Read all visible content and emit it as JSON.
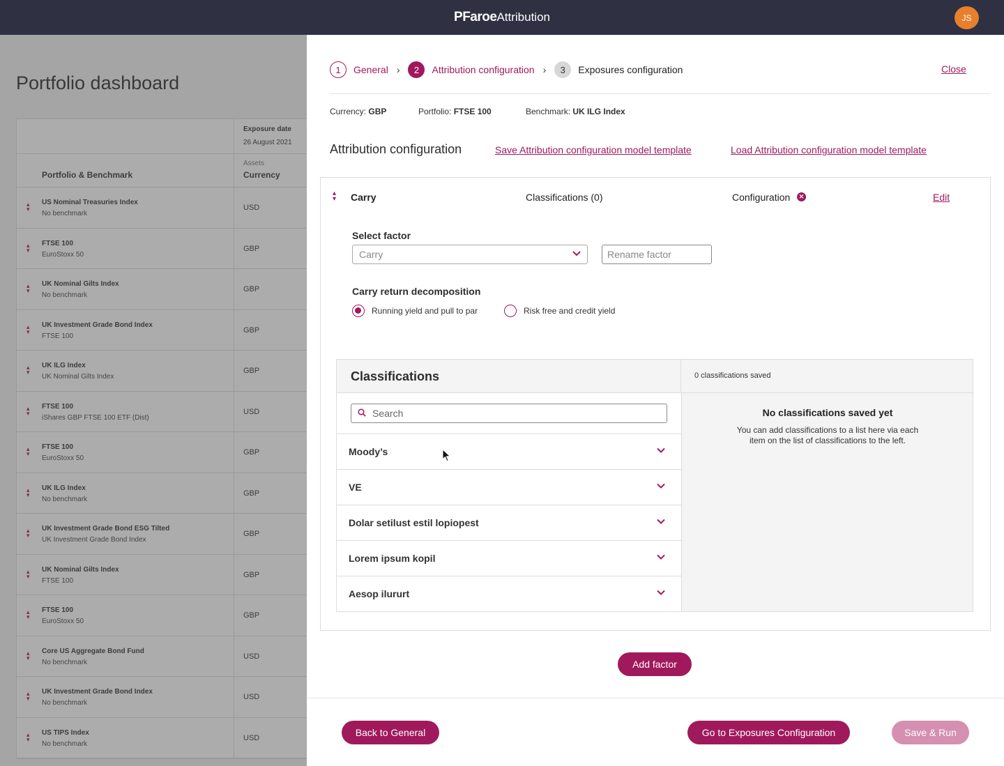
{
  "app": {
    "brand_bold": "PFaroe",
    "brand_rest": "Attribution",
    "avatar_initials": "JS"
  },
  "dashboard": {
    "title": "Portfolio dashboard",
    "exposure_label": "Exposure date",
    "exposure_value": "26 August 2021",
    "col_portfolio": "Portfolio & Benchmark",
    "col_assets": "Assets",
    "col_currency": "Currency",
    "rows": [
      {
        "name": "US Nominal Treasuries Index",
        "bench": "No benchmark",
        "cur": "USD"
      },
      {
        "name": "FTSE 100",
        "bench": "EuroStoxx 50",
        "cur": "GBP"
      },
      {
        "name": "UK Nominal Gilts Index",
        "bench": "No benchmark",
        "cur": "GBP"
      },
      {
        "name": "UK Investment Grade Bond Index",
        "bench": "FTSE 100",
        "cur": "GBP"
      },
      {
        "name": "UK ILG Index",
        "bench": "UK Nominal Gilts Index",
        "cur": "GBP"
      },
      {
        "name": "FTSE 100",
        "bench": "iShares GBP FTSE 100 ETF (Dist)",
        "cur": "USD"
      },
      {
        "name": "FTSE 100",
        "bench": "EuroStoxx 50",
        "cur": "GBP"
      },
      {
        "name": "UK ILG Index",
        "bench": "No benchmark",
        "cur": "GBP"
      },
      {
        "name": "UK Investment Grade Bond ESG Tilted",
        "bench": "UK Investment Grade Bond Index",
        "cur": "GBP"
      },
      {
        "name": "UK Nominal Gilts Index",
        "bench": "FTSE 100",
        "cur": "GBP"
      },
      {
        "name": "FTSE 100",
        "bench": "EuroStoxx 50",
        "cur": "GBP"
      },
      {
        "name": "Core US Aggregate Bond Fund",
        "bench": "No benchmark",
        "cur": "USD"
      },
      {
        "name": "UK Investment Grade Bond Index",
        "bench": "No benchmark",
        "cur": "USD"
      },
      {
        "name": "US TIPS Index",
        "bench": "No benchmark",
        "cur": "USD"
      }
    ]
  },
  "wizard": {
    "steps": [
      {
        "num": "1",
        "label": "General"
      },
      {
        "num": "2",
        "label": "Attribution configuration"
      },
      {
        "num": "3",
        "label": "Exposures configuration"
      }
    ],
    "close_label": "Close",
    "meta": {
      "currency_label": "Currency:",
      "currency_value": "GBP",
      "portfolio_label": "Portfolio:",
      "portfolio_value": "FTSE 100",
      "benchmark_label": "Benchmark:",
      "benchmark_value": "UK ILG Index"
    },
    "section_title": "Attribution configuration",
    "save_template": "Save Attribution configuration model template",
    "load_template": "Load Attribution configuration model template",
    "factor": {
      "name": "Carry",
      "classifications_label": "Classifications (0)",
      "configuration_label": "Configuration",
      "edit_label": "Edit",
      "select_factor_label": "Select factor",
      "select_value": "Carry",
      "rename_placeholder": "Rename factor",
      "decomp_label": "Carry return decomposition",
      "radio_1": "Running yield and pull to par",
      "radio_2": "Risk free and credit yield",
      "radio_selected": 1
    },
    "classifications": {
      "title": "Classifications",
      "saved_count": "0 classifications saved",
      "search_placeholder": "Search",
      "items": [
        "Moody’s",
        "VE",
        "Dolar setilust estil lopiopest",
        "Lorem ipsum kopil",
        "Aesop ilururt"
      ],
      "empty_title": "No classifications saved yet",
      "empty_text": "You can add classifications to a list here via each item on the list of classifications to the left."
    },
    "add_factor": "Add factor",
    "back": "Back to General",
    "next": "Go to Exposures Configuration",
    "save_run": "Save & Run"
  },
  "colors": {
    "accent": "#a0195d",
    "topbar": "#2f3142",
    "avatar": "#e87f2c"
  }
}
